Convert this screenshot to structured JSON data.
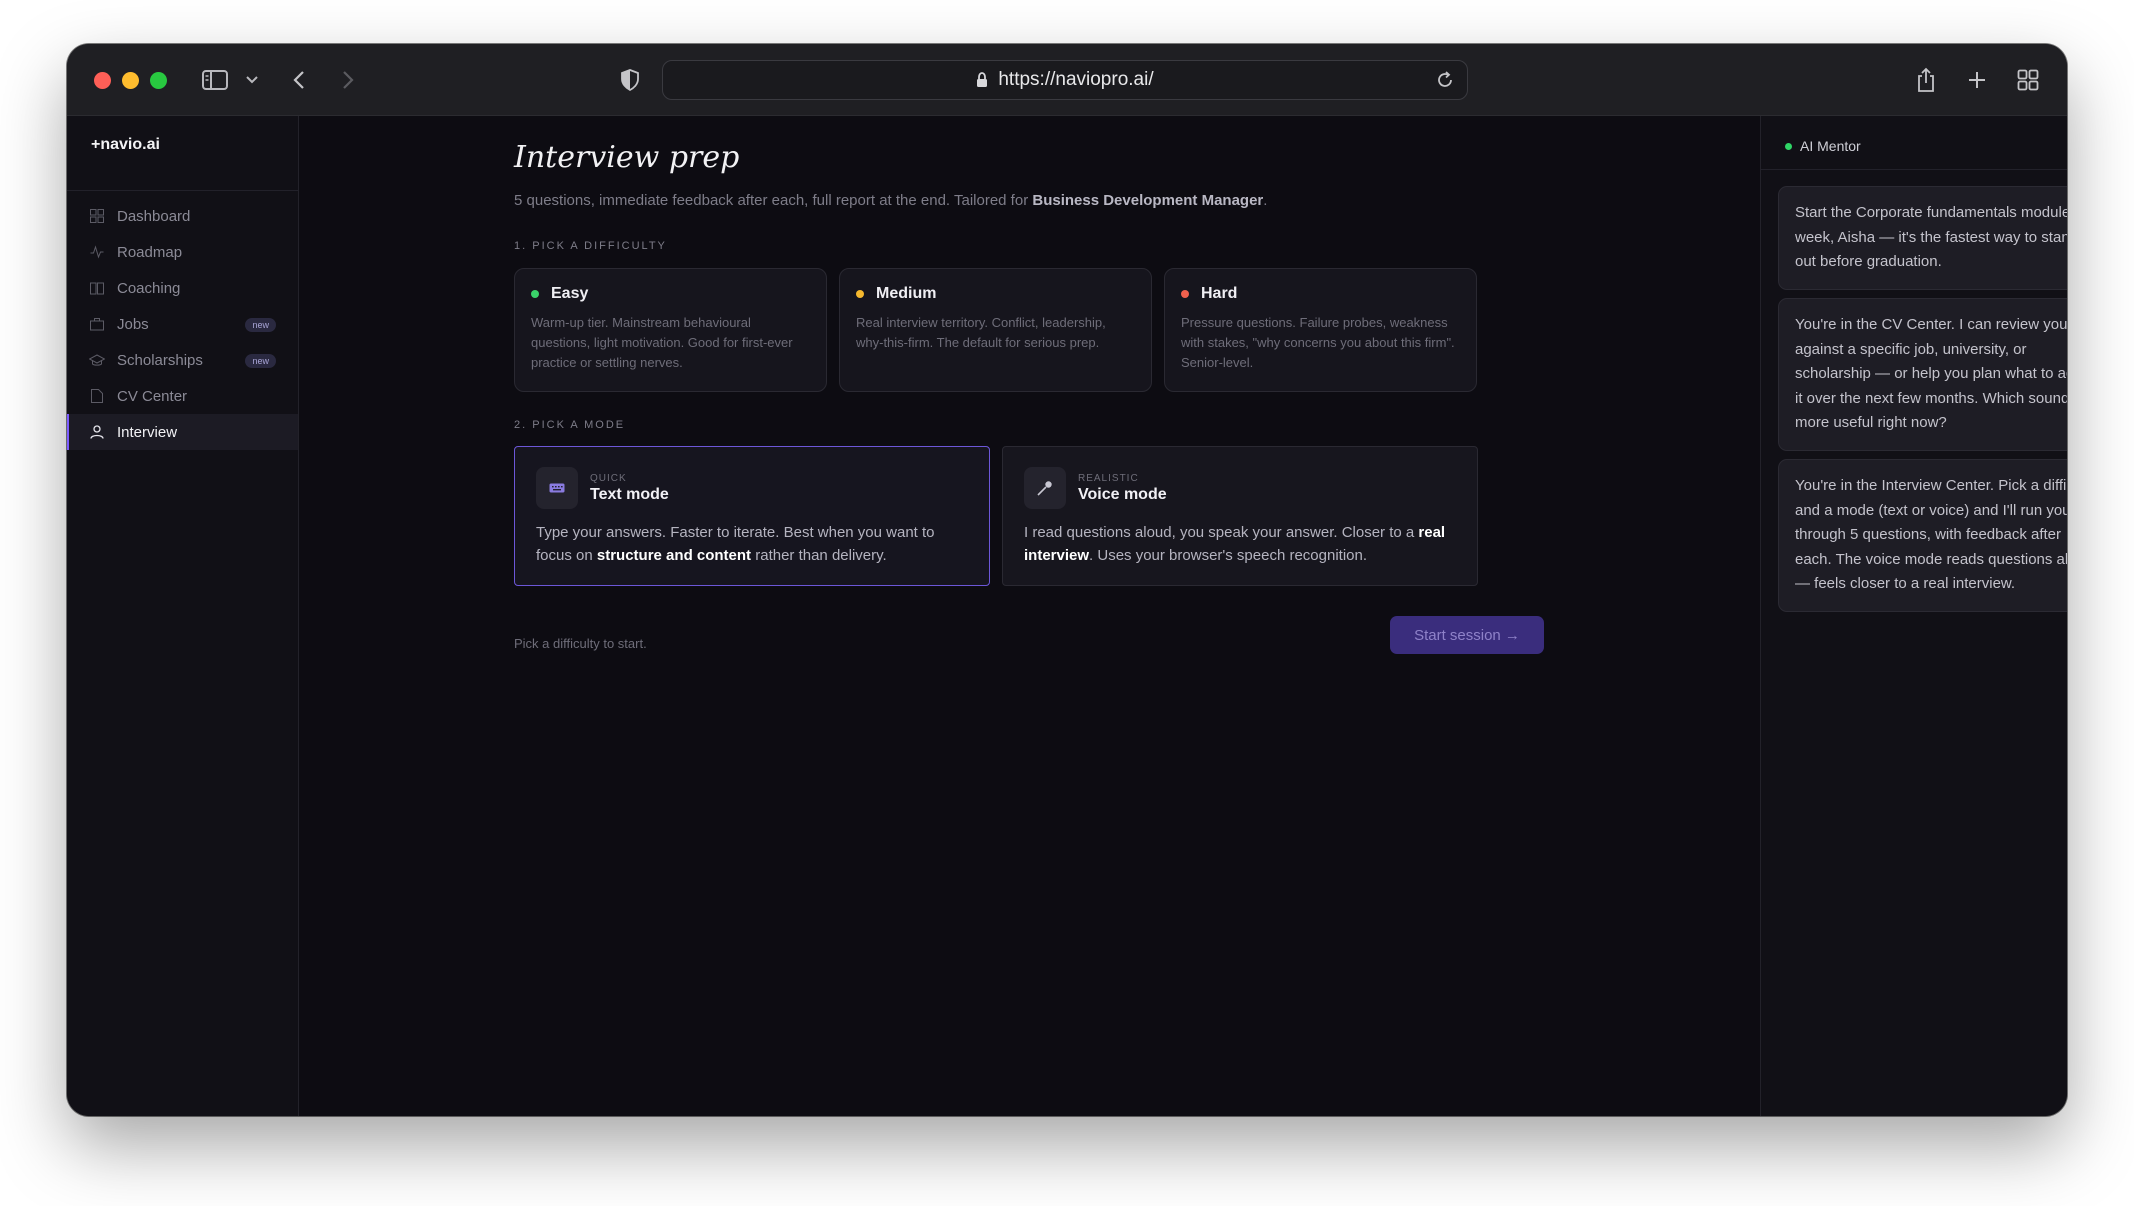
{
  "browser": {
    "url": "https://naviopro.ai/"
  },
  "sidebar": {
    "logo": "+navio.ai",
    "items": [
      {
        "label": "Dashboard",
        "icon": "grid-icon"
      },
      {
        "label": "Roadmap",
        "icon": "activity-icon"
      },
      {
        "label": "Coaching",
        "icon": "book-icon"
      },
      {
        "label": "Jobs",
        "icon": "briefcase-icon",
        "badge": "new"
      },
      {
        "label": "Scholarships",
        "icon": "graduation-cap-icon",
        "badge": "new"
      },
      {
        "label": "CV Center",
        "icon": "file-icon"
      },
      {
        "label": "Interview",
        "icon": "user-icon",
        "active": true
      }
    ]
  },
  "main": {
    "title": "Interview prep",
    "subtitle_prefix": "5 questions, immediate feedback after each, full report at the end. Tailored for ",
    "subtitle_role": "Business Development Manager",
    "subtitle_suffix": ".",
    "difficulty_label": "1. PICK A DIFFICULTY",
    "difficulties": [
      {
        "name": "Easy",
        "color": "#3ad26a",
        "desc": "Warm-up tier. Mainstream behavioural questions, light motivation. Good for first-ever practice or settling nerves."
      },
      {
        "name": "Medium",
        "color": "#f5b82e",
        "desc": "Real interview territory. Conflict, leadership, why-this-firm. The default for serious prep."
      },
      {
        "name": "Hard",
        "color": "#f0604d",
        "desc": "Pressure questions. Failure probes, weakness with stakes, \"why concerns you about this firm\". Senior-level."
      }
    ],
    "mode_label": "2. PICK A MODE",
    "modes": [
      {
        "kicker": "QUICK",
        "title": "Text mode",
        "icon": "keyboard-icon",
        "desc_pre": "Type your answers. Faster to iterate. Best when you want to focus on ",
        "desc_bold": "structure and content",
        "desc_post": " rather than delivery.",
        "selected": true
      },
      {
        "kicker": "REALISTIC",
        "title": "Voice mode",
        "icon": "microphone-icon",
        "desc_pre": "I read questions aloud, you speak your answer. Closer to a ",
        "desc_bold": "real interview",
        "desc_post": ". Uses your browser's speech recognition.",
        "selected": false
      }
    ],
    "hint": "Pick a difficulty to start.",
    "start_button": "Start session →"
  },
  "mentor": {
    "title": "AI Mentor",
    "status_color": "#2fd566",
    "messages": [
      "Start the Corporate fundamentals module this week, Aisha — it's the fastest way to stand out before graduation.",
      "You're in the CV Center. I can review your CV against a specific job, university, or scholarship — or help you plan what to add to it over the next few months. Which sounds more useful right now?",
      "You're in the Interview Center. Pick a difficulty and a mode (text or voice) and I'll run you through 5 questions, with feedback after each. The voice mode reads questions aloud — feels closer to a real interview."
    ]
  },
  "colors": {
    "accent": "#7c5cff",
    "start_button_bg": "#3a2d7d"
  }
}
